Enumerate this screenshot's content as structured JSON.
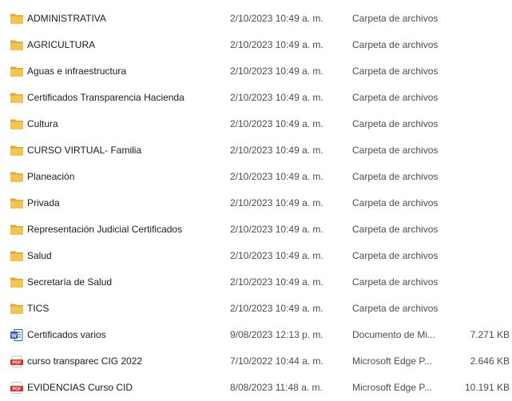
{
  "files": [
    {
      "name": "ADMINISTRATIVA",
      "date": "2/10/2023 10:49 a. m.",
      "type": "Carpeta de archivos",
      "size": "",
      "icon": "folder-icon"
    },
    {
      "name": "AGRICULTURA",
      "date": "2/10/2023 10:49 a. m.",
      "type": "Carpeta de archivos",
      "size": "",
      "icon": "folder-icon"
    },
    {
      "name": "Aguas e infraestructura",
      "date": "2/10/2023 10:49 a. m.",
      "type": "Carpeta de archivos",
      "size": "",
      "icon": "folder-icon"
    },
    {
      "name": "Certificados Transparencia Hacienda",
      "date": "2/10/2023 10:49 a. m.",
      "type": "Carpeta de archivos",
      "size": "",
      "icon": "folder-icon"
    },
    {
      "name": "Cultura",
      "date": "2/10/2023 10:49 a. m.",
      "type": "Carpeta de archivos",
      "size": "",
      "icon": "folder-icon"
    },
    {
      "name": "CURSO VIRTUAL- Familia",
      "date": "2/10/2023 10:49 a. m.",
      "type": "Carpeta de archivos",
      "size": "",
      "icon": "folder-icon"
    },
    {
      "name": "Planeación",
      "date": "2/10/2023 10:49 a. m.",
      "type": "Carpeta de archivos",
      "size": "",
      "icon": "folder-icon"
    },
    {
      "name": "Privada",
      "date": "2/10/2023 10:49 a. m.",
      "type": "Carpeta de archivos",
      "size": "",
      "icon": "folder-icon"
    },
    {
      "name": "Representación Judicial Certificados",
      "date": "2/10/2023 10:49 a. m.",
      "type": "Carpeta de archivos",
      "size": "",
      "icon": "folder-icon"
    },
    {
      "name": "Salud",
      "date": "2/10/2023 10:49 a. m.",
      "type": "Carpeta de archivos",
      "size": "",
      "icon": "folder-icon"
    },
    {
      "name": "Secretaría de Salud",
      "date": "2/10/2023 10:49 a. m.",
      "type": "Carpeta de archivos",
      "size": "",
      "icon": "folder-icon"
    },
    {
      "name": "TICS",
      "date": "2/10/2023 10:49 a. m.",
      "type": "Carpeta de archivos",
      "size": "",
      "icon": "folder-icon"
    },
    {
      "name": "Certificados varios",
      "date": "9/08/2023 12:13 p. m.",
      "type": "Documento de Mi...",
      "size": "7.271 KB",
      "icon": "word-document-icon"
    },
    {
      "name": "curso transparec CIG 2022",
      "date": "7/10/2022 10:44 a. m.",
      "type": "Microsoft Edge P...",
      "size": "2.646 KB",
      "icon": "pdf-file-icon"
    },
    {
      "name": "EVIDENCIAS Curso CID",
      "date": "8/08/2023 11:48 a. m.",
      "type": "Microsoft Edge P...",
      "size": "10.191 KB",
      "icon": "pdf-file-icon"
    }
  ],
  "colors": {
    "folder": "#f4c44e",
    "folder_tab": "#e0a82e",
    "word": "#2b5fb3",
    "pdf": "#d93025"
  }
}
